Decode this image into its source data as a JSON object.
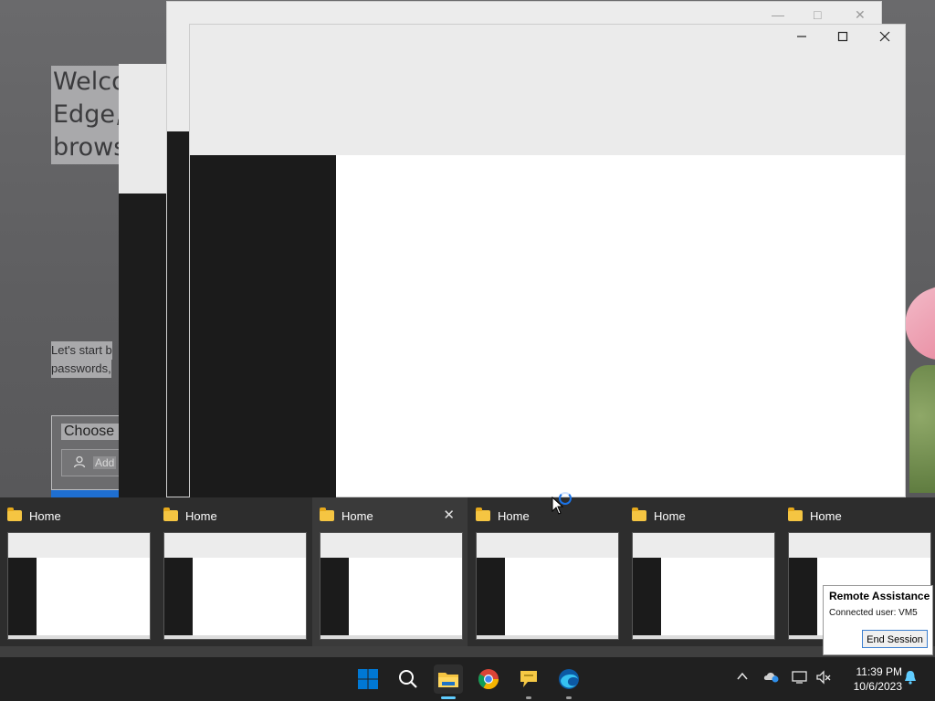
{
  "background": {
    "welcome_lines": [
      "Welco",
      "Edge,",
      "brows"
    ],
    "sub_lines": [
      "Let's start b",
      "passwords,"
    ],
    "choose_label": "Choose a",
    "add_label": "Add"
  },
  "windows": {
    "back": {
      "controls": [
        "minimize-icon",
        "maximize-icon",
        "close-icon"
      ]
    },
    "front": {
      "controls": [
        "minimize-icon",
        "maximize-icon",
        "close-icon"
      ]
    }
  },
  "switcher": {
    "items": [
      {
        "label": "Home"
      },
      {
        "label": "Home"
      },
      {
        "label": "Home",
        "hover": true
      },
      {
        "label": "Home"
      },
      {
        "label": "Home"
      },
      {
        "label": "Home"
      }
    ],
    "close_glyph": "✕"
  },
  "remote_assistance": {
    "title": "Remote Assistance",
    "user_line": "Connected user:  VM5",
    "end_button": "End Session"
  },
  "taskbar": {
    "apps": [
      "start-icon",
      "search-icon",
      "file-explorer-icon",
      "chrome-icon",
      "feedback-icon",
      "edge-icon"
    ],
    "clock_time": "11:39 PM",
    "clock_date": "10/6/2023"
  },
  "colors": {
    "accent": "#60cdff",
    "start_blue": "#0078d4",
    "folder": "#f5c542"
  }
}
